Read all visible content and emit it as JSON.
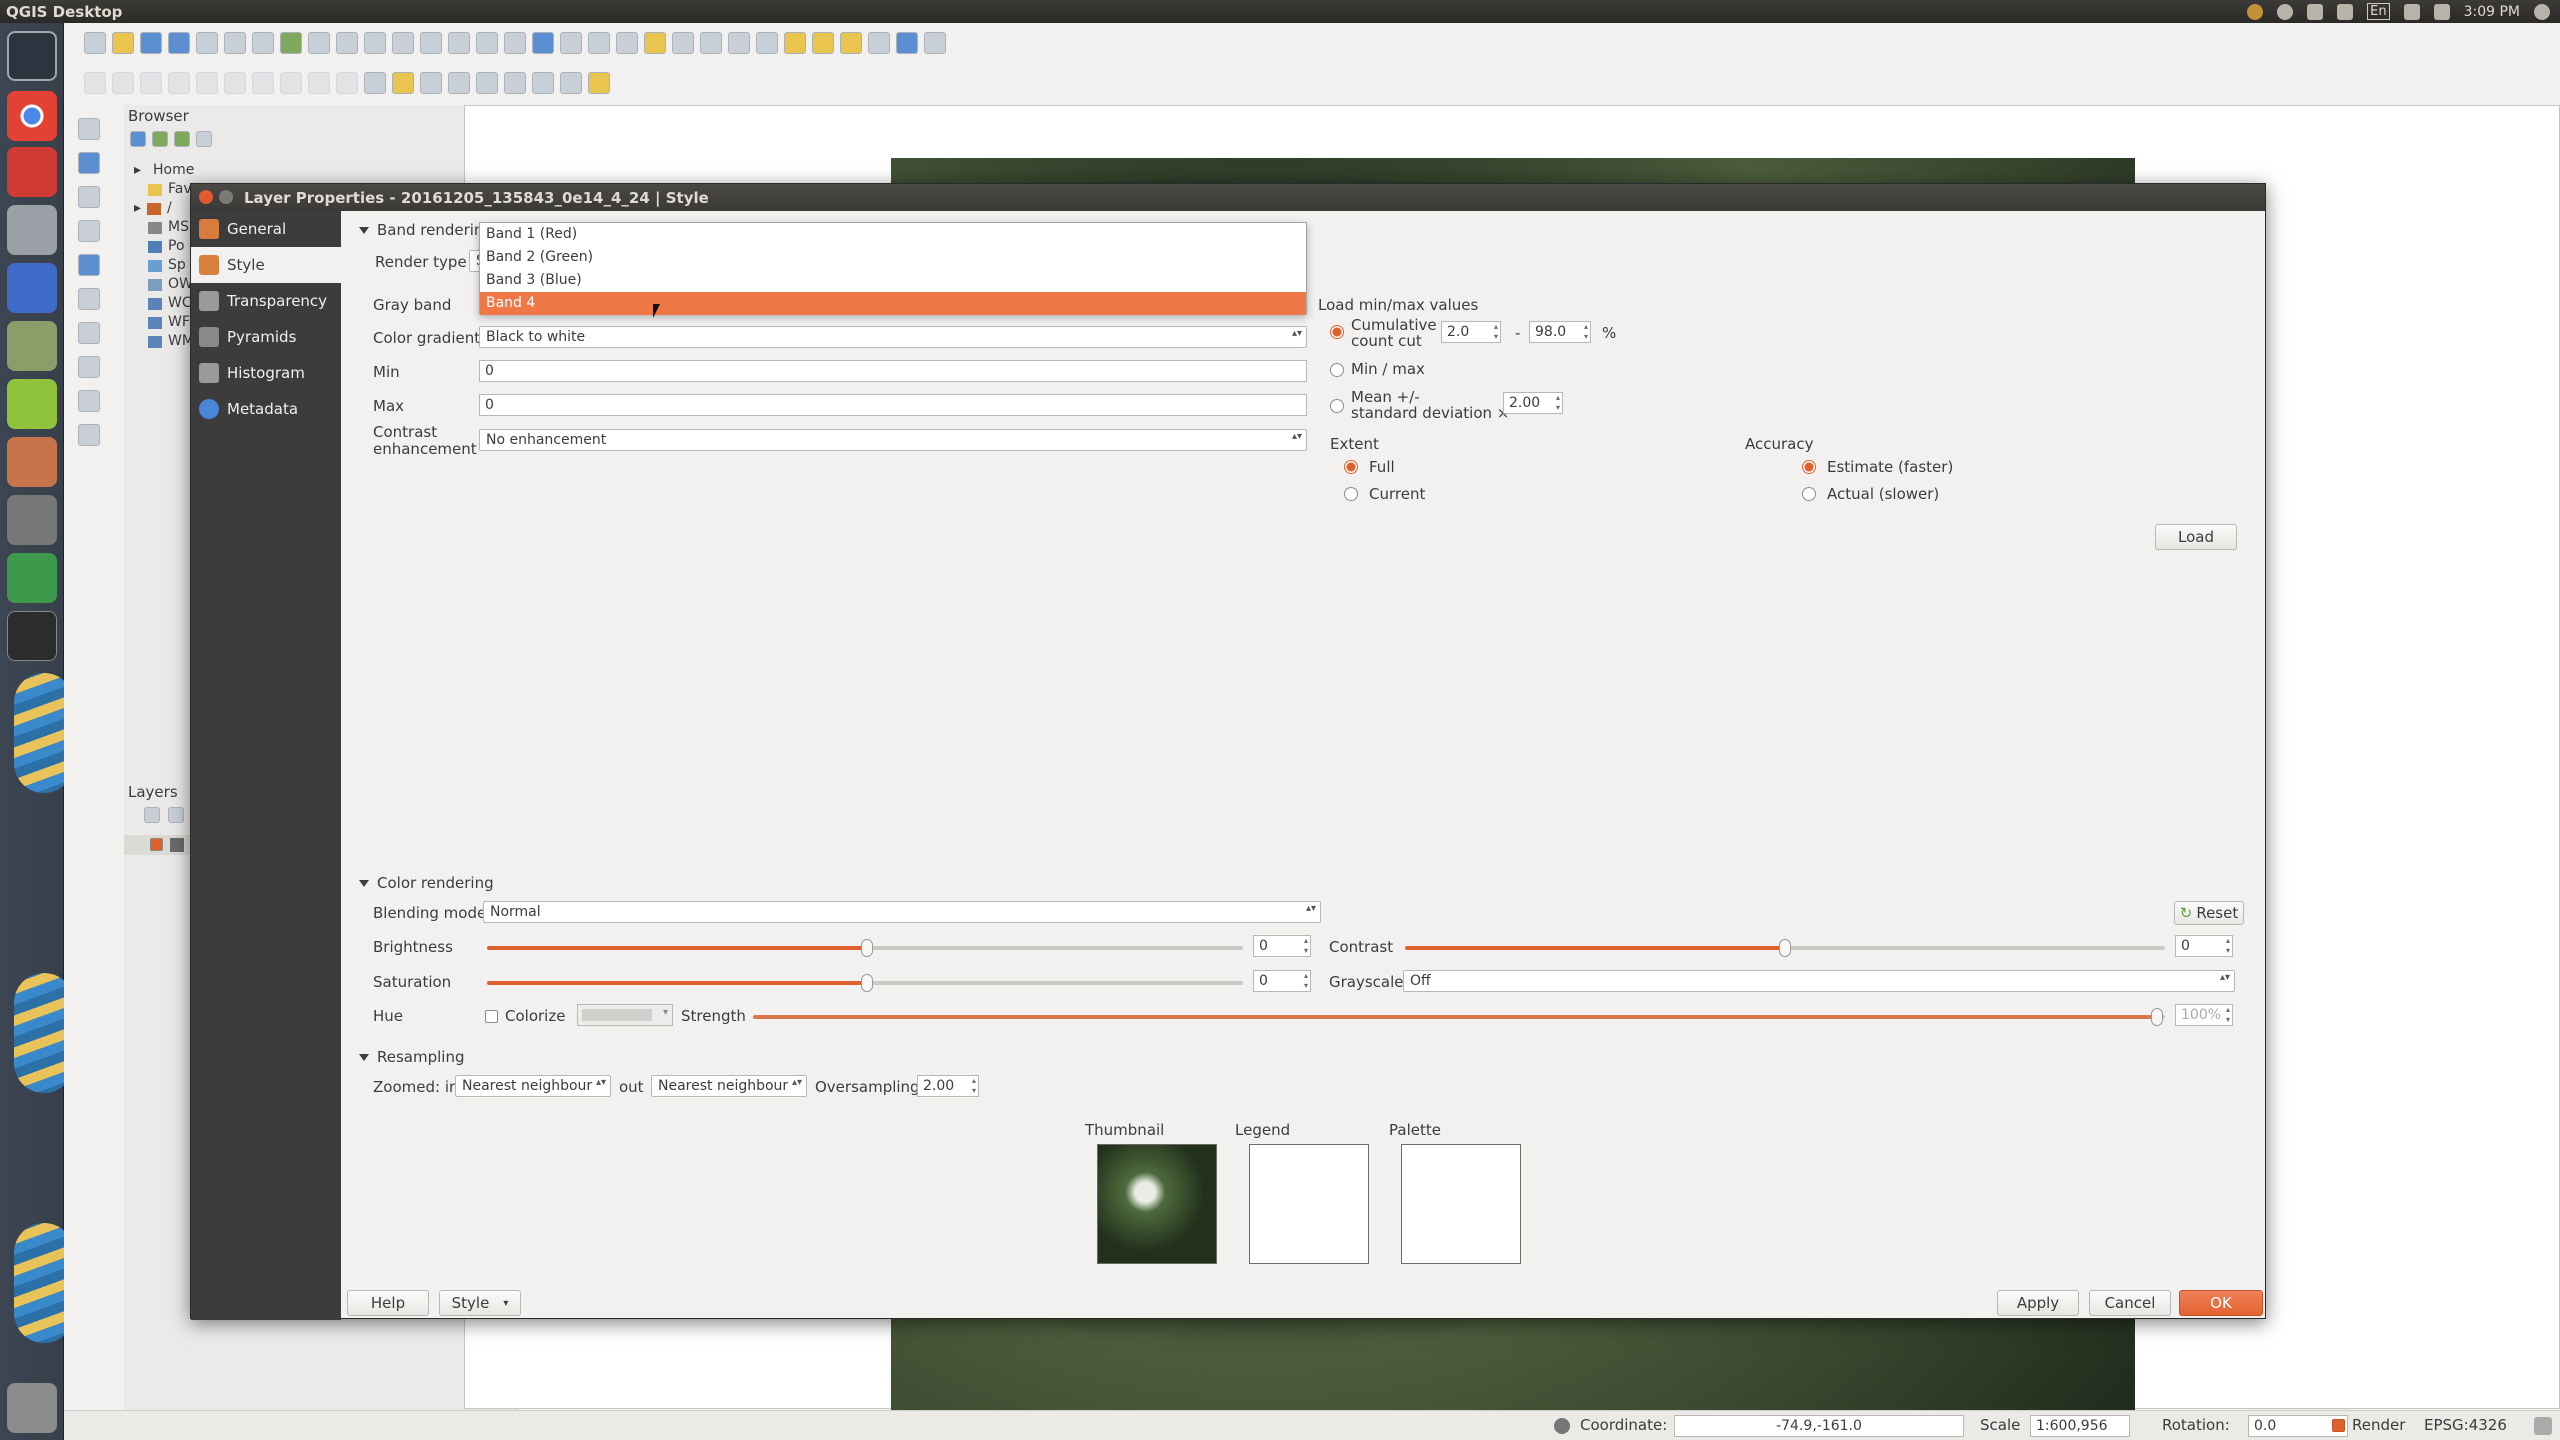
{
  "system": {
    "app_title": "QGIS Desktop",
    "clock": "3:09 PM",
    "keyboard": "En"
  },
  "browser_panel": {
    "title": "Browser",
    "items": [
      "Home",
      "Fav",
      "/",
      "MS",
      "Po",
      "Sp",
      "OW",
      "WC",
      "WF",
      "WM"
    ]
  },
  "layers_panel": {
    "title": "Layers"
  },
  "statusbar": {
    "coordinate_label": "Coordinate:",
    "coordinate_value": "-74.9,-161.0",
    "scale_label": "Scale",
    "scale_value": "1:600,956",
    "rotation_label": "Rotation:",
    "rotation_value": "0.0",
    "render_label": "Render",
    "crs": "EPSG:4326"
  },
  "dialog": {
    "title": "Layer Properties - 20161205_135843_0e14_4_24 | Style",
    "sidebar": [
      {
        "label": "General",
        "icon": "wrench-icon"
      },
      {
        "label": "Style",
        "icon": "brush-icon"
      },
      {
        "label": "Transparency",
        "icon": "transparency-icon"
      },
      {
        "label": "Pyramids",
        "icon": "pyramid-icon"
      },
      {
        "label": "Histogram",
        "icon": "histogram-icon"
      },
      {
        "label": "Metadata",
        "icon": "info-icon"
      }
    ],
    "band_rendering": {
      "section_label": "Band rendering",
      "render_type_label": "Render type",
      "render_type_value": "Si",
      "gray_band_label": "Gray band",
      "band_options": [
        "Band 1 (Red)",
        "Band 2 (Green)",
        "Band 3 (Blue)",
        "Band 4"
      ],
      "band_selected": "Band 4",
      "color_gradient_label": "Color gradient",
      "color_gradient_value": "Black to white",
      "min_label": "Min",
      "min_value": "0",
      "max_label": "Max",
      "max_value": "0",
      "contrast_label_1": "Contrast",
      "contrast_label_2": "enhancement",
      "contrast_value": "No enhancement"
    },
    "minmax": {
      "title": "Load min/max values",
      "cumulative_label_1": "Cumulative",
      "cumulative_label_2": "count cut",
      "cum_low": "2.0",
      "cum_sep": "-",
      "cum_high": "98.0",
      "percent": "%",
      "minmax_label": "Min / max",
      "mean_label_1": "Mean +/-",
      "mean_label_2": "standard deviation ×",
      "mean_value": "2.00",
      "extent_title": "Extent",
      "extent_full": "Full",
      "extent_current": "Current",
      "accuracy_title": "Accuracy",
      "accuracy_estimate": "Estimate (faster)",
      "accuracy_actual": "Actual (slower)",
      "load_button": "Load"
    },
    "color_rendering": {
      "section_label": "Color rendering",
      "blending_label": "Blending mode",
      "blending_value": "Normal",
      "reset_button": "Reset",
      "brightness_label": "Brightness",
      "brightness_value": "0",
      "brightness_level": 0.5,
      "contrast_label": "Contrast",
      "contrast_value": "0",
      "contrast_level": 0.5,
      "saturation_label": "Saturation",
      "saturation_value": "0",
      "saturation_level": 0.5,
      "grayscale_label": "Grayscale",
      "grayscale_value": "Off",
      "hue_label": "Hue",
      "colorize_label": "Colorize",
      "strength_label": "Strength",
      "strength_value": "100%",
      "strength_level": 1.0
    },
    "resampling": {
      "section_label": "Resampling",
      "zoomed_in_label": "Zoomed: in",
      "zoomed_in_value": "Nearest neighbour",
      "out_label": "out",
      "out_value": "Nearest neighbour",
      "oversampling_label": "Oversampling",
      "oversampling_value": "2.00"
    },
    "previews": {
      "thumbnail": "Thumbnail",
      "legend": "Legend",
      "palette": "Palette"
    },
    "footer": {
      "help": "Help",
      "style": "Style",
      "apply": "Apply",
      "cancel": "Cancel",
      "ok": "OK"
    }
  },
  "colors": {
    "accent": "#e0602b",
    "sidebar_bg": "#3c3c3c"
  }
}
